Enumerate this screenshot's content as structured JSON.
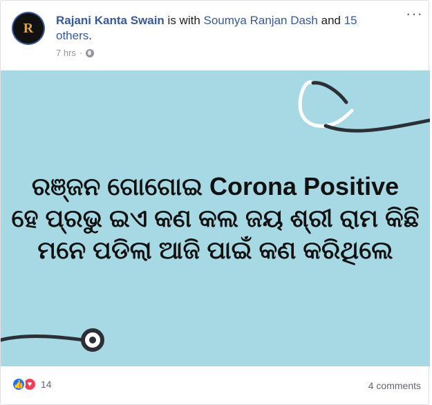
{
  "post": {
    "author_name": "Rajani Kanta Swain",
    "with_text": " is with ",
    "tagged_person": "Soumya Ranjan Dash",
    "and_text": " and ",
    "others_text": "15 others",
    "period": ".",
    "timestamp": "7 hrs",
    "dot_separator": "·",
    "more_icon": "···",
    "avatar_letter": "R",
    "text_lines": [
      "ରଞ୍ଜନ ଗୋଗୋଇ Corona Positive",
      "ହେ ପ୍ରଭୁ ଇଏ କଣ କଲ ଜୟ ଶ୍ରୀ ରାମ କିଛି",
      "ମନେ ପଡିଲା ଆଜି ପାଇଁ କଣ କରିଥିଲେ"
    ],
    "reaction_count": "14",
    "comments": "4 comments",
    "like_glyph": "👍",
    "love_glyph": "♥"
  },
  "colors": {
    "link": "#385898",
    "image_background": "#a6d9e3",
    "like": "#1877f2",
    "love": "#f33e58"
  },
  "icons": [
    "globe-icon",
    "more-icon",
    "like-icon",
    "love-icon",
    "stethoscope-icon"
  ]
}
